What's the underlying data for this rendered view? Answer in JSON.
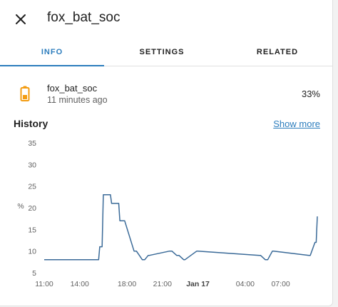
{
  "header": {
    "title": "fox_bat_soc",
    "close_icon": "close-icon"
  },
  "tabs": [
    {
      "label": "INFO",
      "active": true
    },
    {
      "label": "SETTINGS",
      "active": false
    },
    {
      "label": "RELATED",
      "active": false
    }
  ],
  "entity": {
    "icon": "battery-icon",
    "icon_color": "#f39c12",
    "name": "fox_bat_soc",
    "last_changed": "11 minutes ago",
    "state": "33%"
  },
  "history": {
    "title": "History",
    "show_more": "Show more"
  },
  "colors": {
    "accent": "#2c7dbd",
    "line": "#3a6a98"
  },
  "chart_data": {
    "type": "line",
    "ylabel": "%",
    "ylim": [
      5,
      35
    ],
    "y_ticks": [
      "35",
      "30",
      "25",
      "20",
      "15",
      "10",
      "5"
    ],
    "x_ticks": [
      {
        "label": "11:00",
        "hour": 11,
        "bold": false
      },
      {
        "label": "14:00",
        "hour": 14,
        "bold": false
      },
      {
        "label": "18:00",
        "hour": 18,
        "bold": false
      },
      {
        "label": "21:00",
        "hour": 21,
        "bold": false
      },
      {
        "label": "Jan 17",
        "hour": 24,
        "bold": true
      },
      {
        "label": "04:00",
        "hour": 28,
        "bold": false
      },
      {
        "label": "07:00",
        "hour": 31,
        "bold": false
      }
    ],
    "xlim_hours": [
      11,
      34.4
    ],
    "series": [
      {
        "x": [
          11,
          15.6,
          15.7,
          15.9,
          16.0,
          16.6,
          16.7,
          17.3,
          17.4,
          17.8,
          18.6,
          18.8,
          19.3,
          19.5,
          19.8,
          19.9,
          21.6,
          21.8,
          22.2,
          22.4,
          22.8,
          22.9,
          23.9,
          24.0,
          29.2,
          29.3,
          29.7,
          29.9,
          30.3,
          30.4,
          33.4,
          33.5,
          33.9,
          34.0,
          34.1
        ],
        "values": [
          8,
          8,
          11,
          11,
          23,
          23,
          21,
          21,
          17,
          17,
          10,
          10,
          8,
          8,
          9,
          9,
          10,
          10,
          9,
          9,
          8,
          8,
          10,
          10,
          9,
          9,
          8,
          8,
          10,
          10,
          9,
          9,
          12,
          12,
          18
        ]
      }
    ]
  }
}
